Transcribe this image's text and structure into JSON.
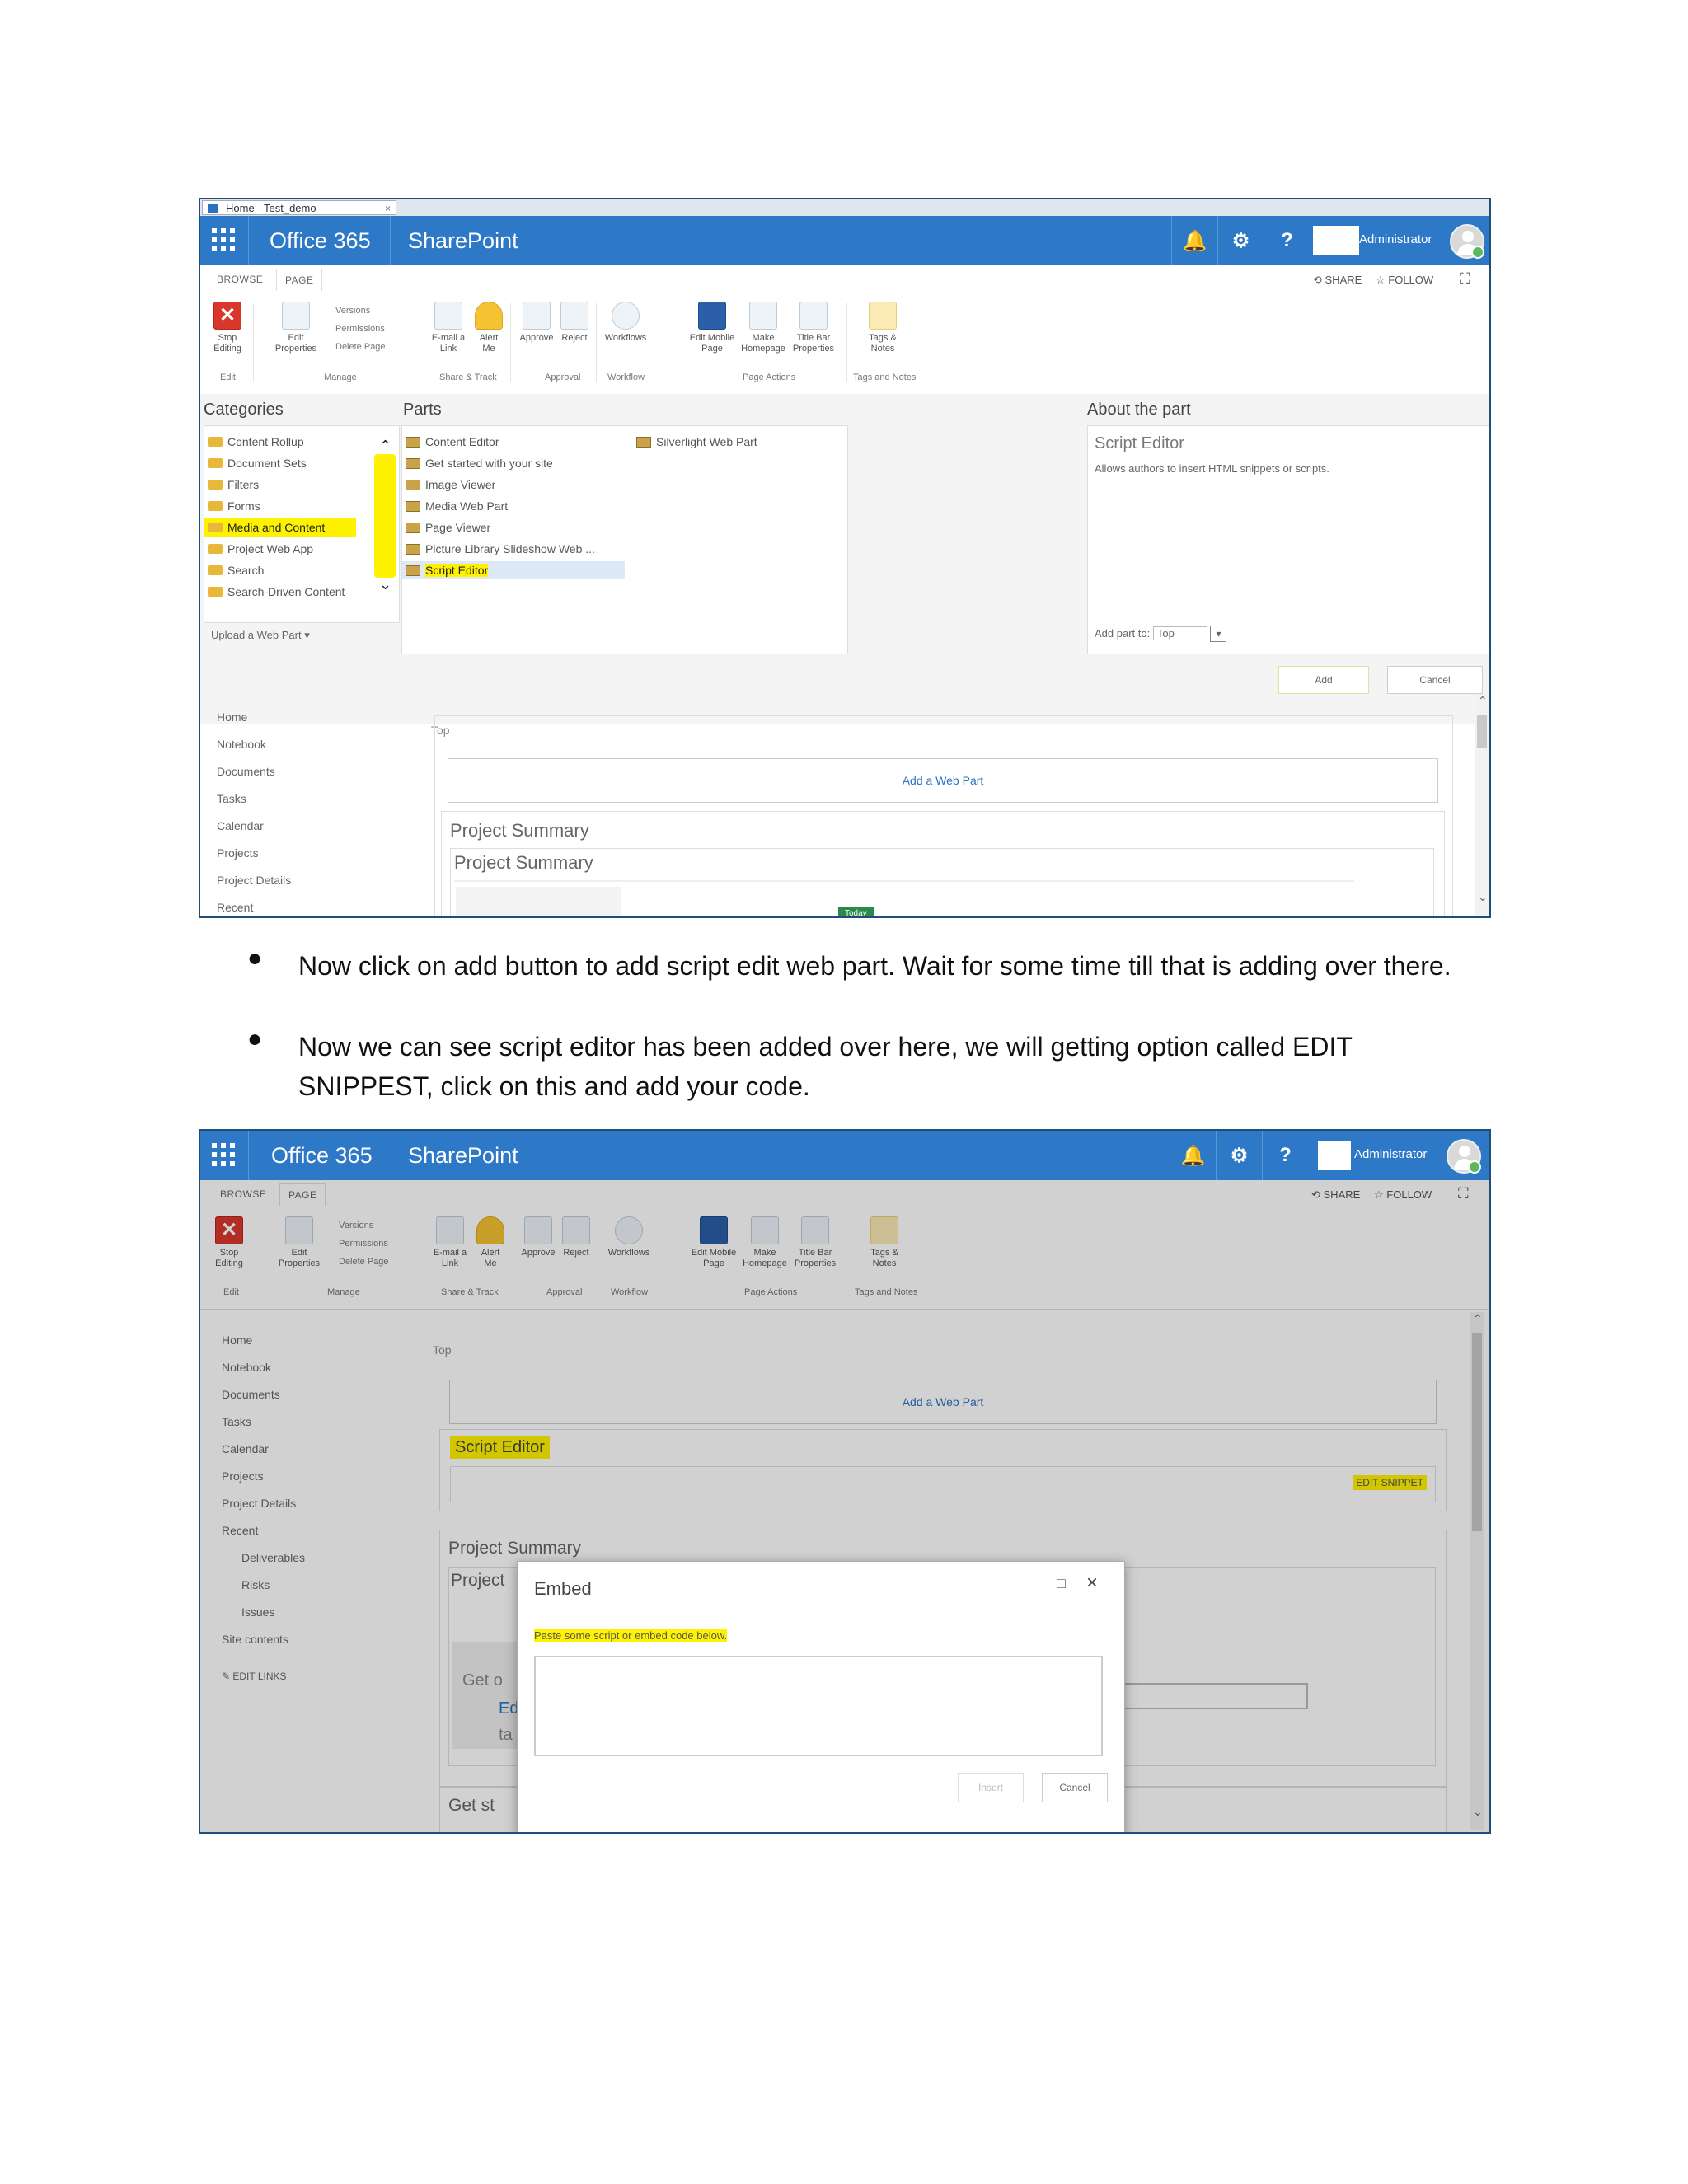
{
  "screenshot1": {
    "browser_tab": {
      "title": "Home - Test_demo",
      "close": "×"
    },
    "suite_bar": {
      "app_name": "Office 365",
      "product": "SharePoint",
      "user": "Administrator"
    },
    "tabs": [
      "BROWSE",
      "PAGE"
    ],
    "actions": {
      "share": "SHARE",
      "follow": "FOLLOW"
    },
    "ribbon": {
      "buttons": [
        {
          "label": "Stop Editing",
          "icon": "stop-editing-icon"
        },
        {
          "label": "Edit Properties",
          "icon": "edit-properties-icon"
        },
        {
          "label": "E-mail a Link",
          "icon": "email-icon"
        },
        {
          "label": "Alert Me",
          "icon": "bell-icon"
        },
        {
          "label": "Approve",
          "icon": "approve-icon"
        },
        {
          "label": "Reject",
          "icon": "reject-icon"
        },
        {
          "label": "Workflows",
          "icon": "workflow-icon"
        },
        {
          "label": "Edit Mobile Page",
          "icon": "mobile-page-icon"
        },
        {
          "label": "Make Homepage",
          "icon": "homepage-icon"
        },
        {
          "label": "Title Bar Properties",
          "icon": "title-bar-icon"
        },
        {
          "label": "Tags & Notes",
          "icon": "tags-icon"
        }
      ],
      "small_items": [
        "Versions",
        "Permissions",
        "Delete Page"
      ],
      "groups": [
        "Edit",
        "Manage",
        "Share & Track",
        "Approval",
        "Workflow",
        "Page Actions",
        "Tags and Notes"
      ]
    },
    "categories": {
      "heading": "Categories",
      "items": [
        "Content Rollup",
        "Document Sets",
        "Filters",
        "Forms",
        "Media and Content",
        "Project Web App",
        "Search",
        "Search-Driven Content"
      ],
      "selected": "Media and Content",
      "upload": "Upload a Web Part"
    },
    "parts": {
      "heading": "Parts",
      "items": [
        "Content Editor",
        "Get started with your site",
        "Image Viewer",
        "Media Web Part",
        "Page Viewer",
        "Picture Library Slideshow Web ...",
        "Script Editor"
      ],
      "selected": "Script Editor",
      "column2": [
        "Silverlight Web Part"
      ]
    },
    "about": {
      "heading": "About the part",
      "title": "Script Editor",
      "description": "Allows authors to insert HTML snippets or scripts.",
      "add_part_label": "Add part to:",
      "zone": "Top"
    },
    "buttons": {
      "add": "Add",
      "cancel": "Cancel"
    },
    "left_nav": [
      "Home",
      "Notebook",
      "Documents",
      "Tasks",
      "Calendar",
      "Projects",
      "Project Details",
      "Recent"
    ],
    "zone_label": "Top",
    "add_web_part": "Add a Web Part",
    "webpart_title": "Project Summary",
    "webpart_inner_title": "Project Summary",
    "footer_badge": "Today"
  },
  "instructions": [
    "Now click on add button to add script edit web part. Wait for some time till that is adding over there.",
    "Now we can see script editor has been added over here, we will getting option called EDIT SNIPPEST, click on this and add your code."
  ],
  "screenshot2": {
    "suite_bar": {
      "app_name": "Office 365",
      "product": "SharePoint",
      "user": "Administrator"
    },
    "tabs": [
      "BROWSE",
      "PAGE"
    ],
    "actions": {
      "share": "SHARE",
      "follow": "FOLLOW"
    },
    "left_nav": [
      "Home",
      "Notebook",
      "Documents",
      "Tasks",
      "Calendar",
      "Projects",
      "Project Details",
      "Recent"
    ],
    "left_nav_sub": [
      "Deliverables",
      "Risks",
      "Issues"
    ],
    "site_contents": "Site contents",
    "edit_links": "EDIT LINKS",
    "zone_label": "Top",
    "add_web_part": "Add a Web Part",
    "script_editor_title": "Script Editor",
    "edit_snippet": "EDIT SNIPPET",
    "project_summary": "Project Summary",
    "project_partial": "Project",
    "get_started_partial": "Get st",
    "get_started_bg": "Get o",
    "bg_ed": "Ed",
    "bg_ta": "ta",
    "dialog": {
      "title": "Embed",
      "instruction": "Paste some script or embed code below.",
      "insert": "Insert",
      "cancel": "Cancel",
      "maximize": "□",
      "close": "×"
    }
  },
  "colors": {
    "suite_bar": "#2d78c7",
    "highlight": "#fff200",
    "link": "#2a72c0"
  }
}
